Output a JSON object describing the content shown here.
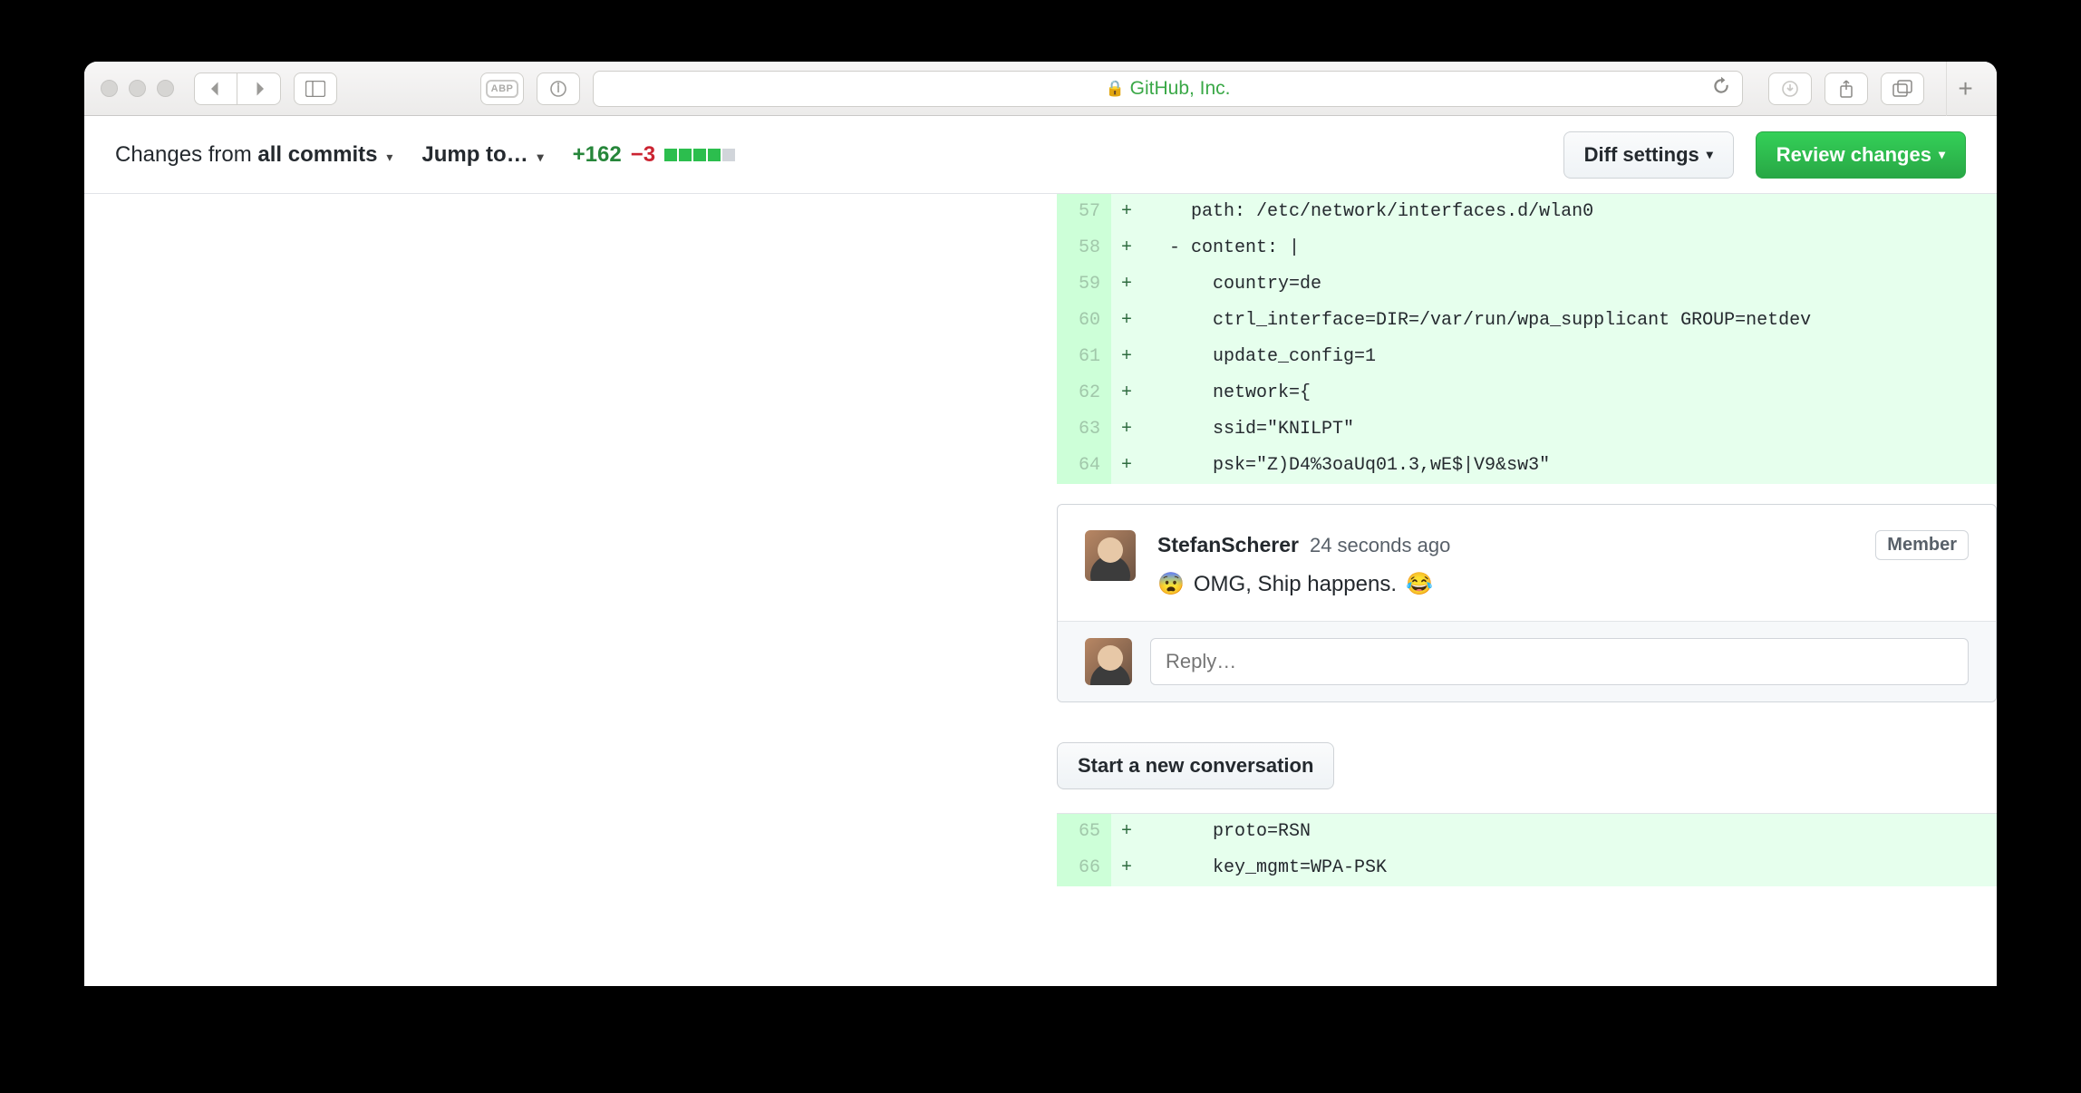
{
  "browser": {
    "site_label": "GitHub, Inc."
  },
  "toolbar": {
    "changes_from_prefix": "Changes from ",
    "changes_from_value": "all commits",
    "jump_to": "Jump to…",
    "additions": "+162",
    "deletions": "−3",
    "squares_green": 4,
    "squares_grey": 1,
    "diff_settings": "Diff settings",
    "review_changes": "Review changes"
  },
  "diff": {
    "lines": [
      {
        "n": "57",
        "text": "    path: /etc/network/interfaces.d/wlan0",
        "cls": ""
      },
      {
        "n": "58",
        "text": "  - content: |",
        "cls": "yaml-key"
      },
      {
        "n": "59",
        "text": "      country=de",
        "cls": ""
      },
      {
        "n": "60",
        "text": "      ctrl_interface=DIR=/var/run/wpa_supplicant GROUP=netdev",
        "cls": ""
      },
      {
        "n": "61",
        "text": "      update_config=1",
        "cls": ""
      },
      {
        "n": "62",
        "text": "      network={",
        "cls": ""
      },
      {
        "n": "63",
        "text": "      ssid=\"KNILPT\"",
        "cls": ""
      },
      {
        "n": "64",
        "text": "      psk=\"Z)D4%3oaUq01.3,wE$|V9&sw3\"",
        "cls": ""
      }
    ],
    "lines_after": [
      {
        "n": "65",
        "text": "      proto=RSN",
        "cls": ""
      },
      {
        "n": "66",
        "text": "      key_mgmt=WPA-PSK",
        "cls": ""
      }
    ]
  },
  "comment": {
    "author": "StefanScherer",
    "time": "24 seconds ago",
    "badge": "Member",
    "text": "OMG, Ship happens.",
    "emoji_before": "😨",
    "emoji_after": "😂"
  },
  "reply": {
    "placeholder": "Reply…"
  },
  "new_conversation": "Start a new conversation"
}
